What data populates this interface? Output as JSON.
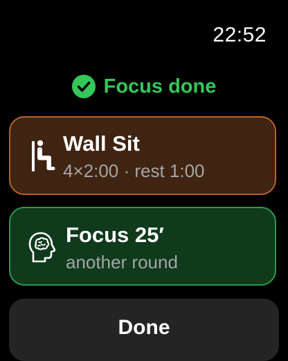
{
  "status_bar": {
    "time": "22:52"
  },
  "status": {
    "icon": "checkmark-circle-icon",
    "text": "Focus done",
    "color": "#34c759"
  },
  "cards": [
    {
      "icon": "wall-sit-person-icon",
      "title": "Wall Sit",
      "subtitle": "4×2:00 · rest 1:00",
      "accent": "#b8622a",
      "background": "#3f2412"
    },
    {
      "icon": "brain-head-icon",
      "title": "Focus 25′",
      "subtitle": "another round",
      "accent": "#2e9a4a",
      "background": "#0f3a1c"
    }
  ],
  "done_button": {
    "label": "Done"
  }
}
